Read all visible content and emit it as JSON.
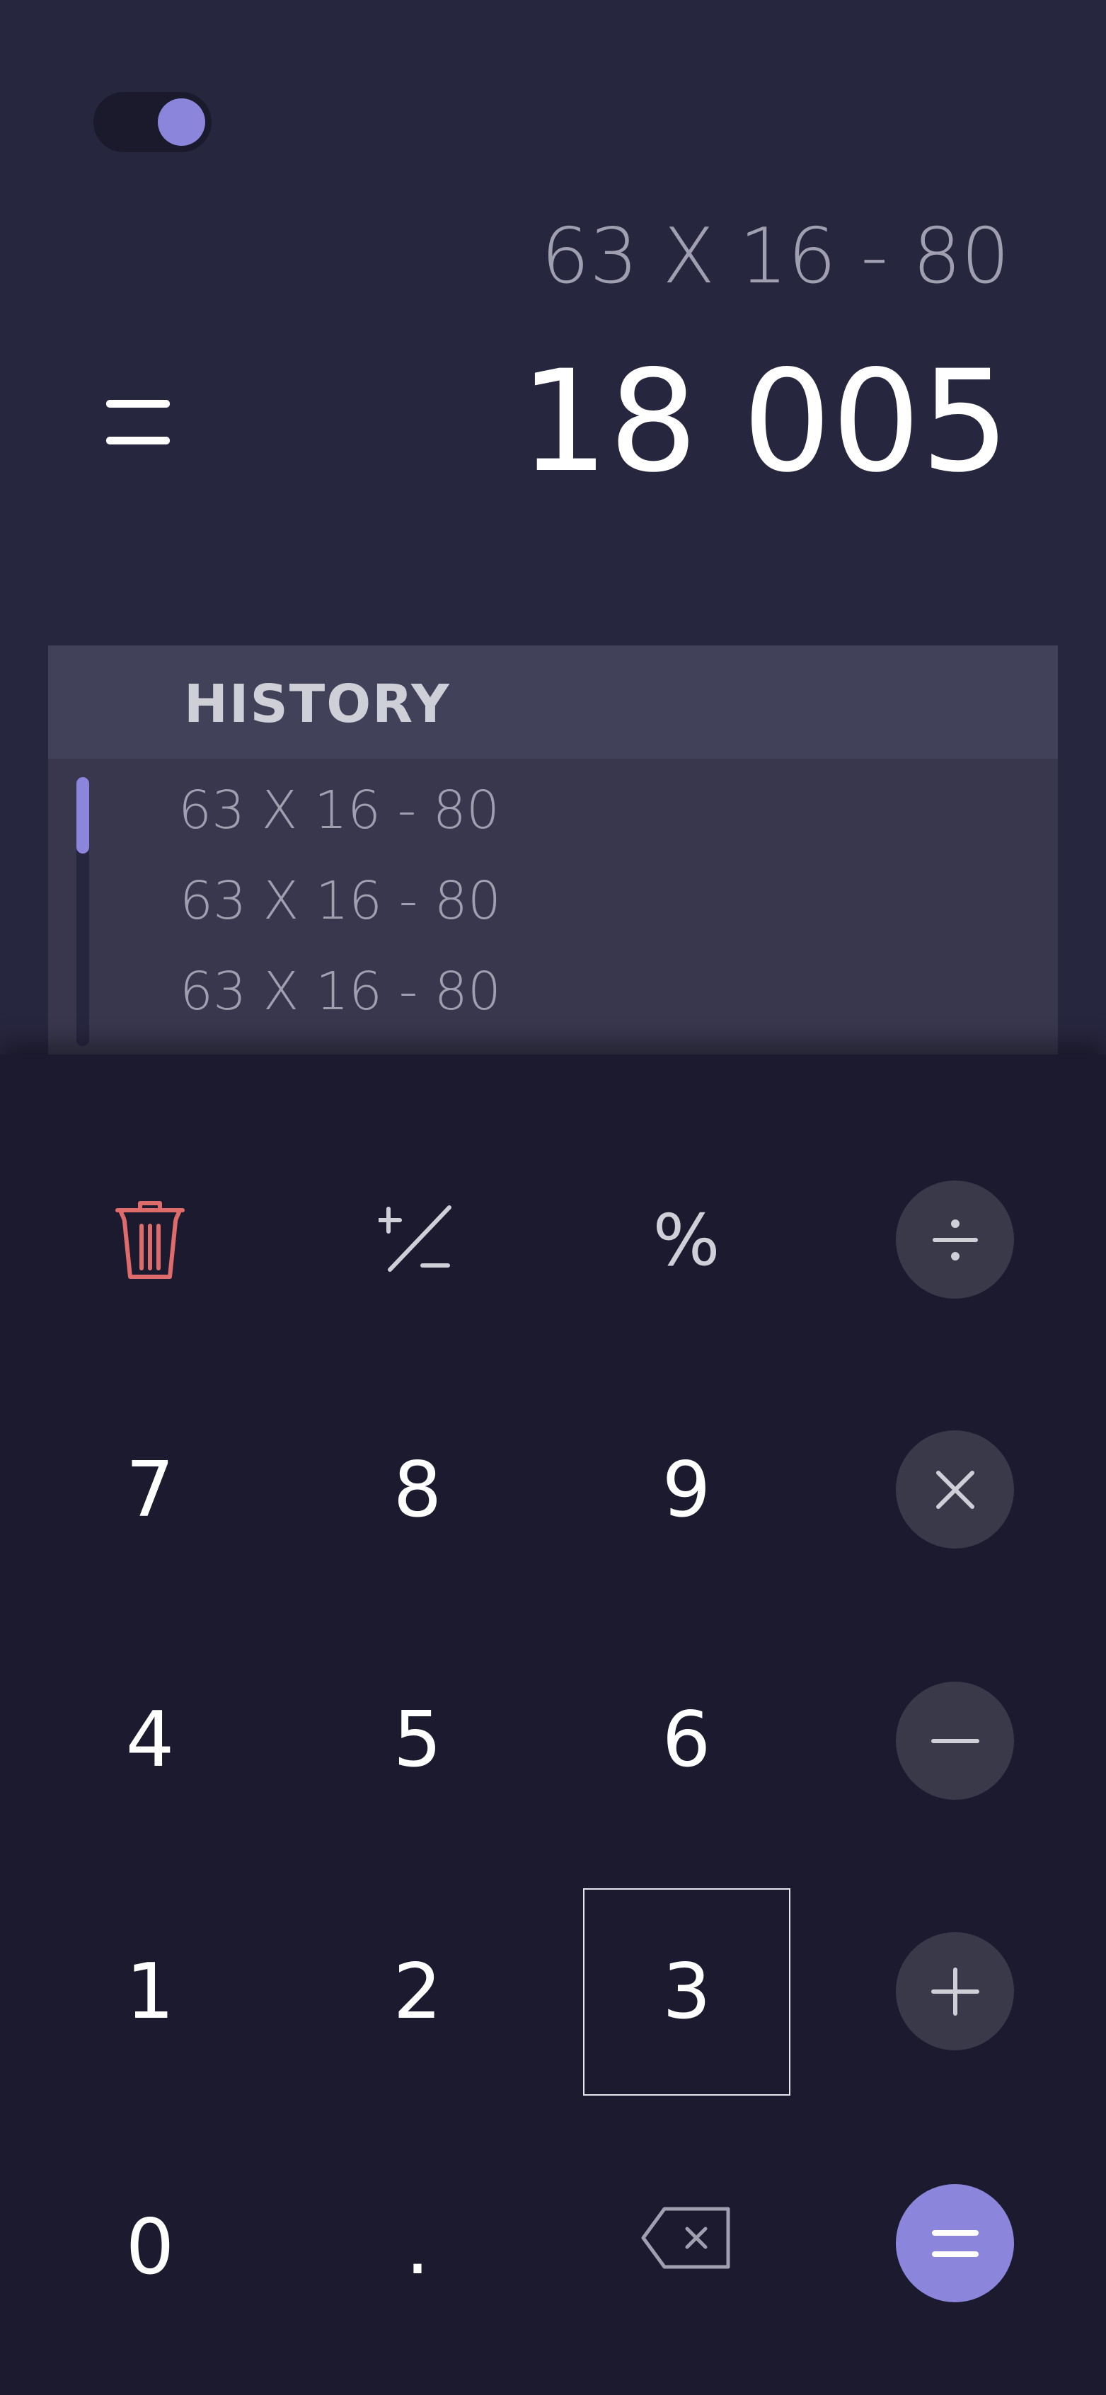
{
  "display": {
    "expression": "63 X 16 - 80",
    "result": "18 005"
  },
  "history": {
    "title": "HISTORY",
    "items": [
      "63 X 16 - 80",
      "63 X 16 - 80",
      "63 X 16 - 80"
    ]
  },
  "keys": {
    "percent": "%",
    "seven": "7",
    "eight": "8",
    "nine": "9",
    "four": "4",
    "five": "5",
    "six": "6",
    "one": "1",
    "two": "2",
    "three": "3",
    "zero": "0",
    "dot": "."
  },
  "colors": {
    "accent": "#8b86dc",
    "delete": "#e06b6b",
    "display_bg": "#27263f",
    "keypad_bg": "#1b1a2e"
  },
  "icons": {
    "theme_toggle": "toggle-icon",
    "clear": "trash-icon",
    "sign": "plus-minus-icon",
    "divide": "divide-icon",
    "multiply": "multiply-icon",
    "subtract": "minus-icon",
    "add": "plus-icon",
    "backspace": "backspace-icon",
    "equals": "equals-icon"
  }
}
